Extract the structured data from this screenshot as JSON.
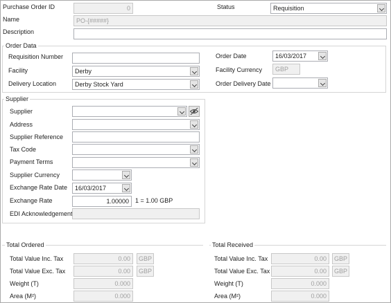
{
  "header": {
    "po_id_label": "Purchase Order ID",
    "po_id_value": "0",
    "status_label": "Status",
    "status_value": "Requisition",
    "name_label": "Name",
    "name_placeholder": "PO-{#####}",
    "description_label": "Description",
    "description_value": ""
  },
  "order_data": {
    "title": "Order Data",
    "requisition_number_label": "Requisition Number",
    "requisition_number_value": "",
    "facility_label": "Facility",
    "facility_value": "Derby",
    "delivery_location_label": "Delivery Location",
    "delivery_location_value": "Derby Stock Yard",
    "order_date_label": "Order Date",
    "order_date_value": "16/03/2017",
    "facility_currency_label": "Facility Currency",
    "facility_currency_value": "GBP",
    "order_delivery_date_label": "Order Delivery Date",
    "order_delivery_date_value": ""
  },
  "supplier": {
    "title": "Supplier",
    "supplier_label": "Supplier",
    "supplier_value": "",
    "address_label": "Address",
    "address_value": "",
    "supplier_reference_label": "Supplier Reference",
    "supplier_reference_value": "",
    "tax_code_label": "Tax Code",
    "tax_code_value": "",
    "payment_terms_label": "Payment Terms",
    "payment_terms_value": "",
    "supplier_currency_label": "Supplier Currency",
    "supplier_currency_value": "",
    "exchange_rate_date_label": "Exchange Rate Date",
    "exchange_rate_date_value": "16/03/2017",
    "exchange_rate_label": "Exchange Rate",
    "exchange_rate_value": "1.00000",
    "exchange_rate_note": "1  = 1.00 GBP",
    "edi_label": "EDI Acknowledgement",
    "edi_value": ""
  },
  "totals": {
    "ordered": {
      "title": "Total Ordered",
      "inc_tax_label": "Total Value Inc. Tax",
      "inc_tax_value": "0.00",
      "inc_tax_unit": "GBP",
      "exc_tax_label": "Total Value Exc. Tax",
      "exc_tax_value": "0.00",
      "exc_tax_unit": "GBP",
      "weight_label": "Weight (T)",
      "weight_value": "0.000",
      "area_label": "Area (M²)",
      "area_value": "0.000"
    },
    "received": {
      "title": "Total Received",
      "inc_tax_label": "Total Value Inc. Tax",
      "inc_tax_value": "0.00",
      "inc_tax_unit": "GBP",
      "exc_tax_label": "Total Value Exc. Tax",
      "exc_tax_value": "0.00",
      "exc_tax_unit": "GBP",
      "weight_label": "Weight (T)",
      "weight_value": "0.000",
      "area_label": "Area (M²)",
      "area_value": "0.000"
    }
  },
  "icons": {
    "dropdown": "chevron-down-icon",
    "supplier_lookup": "eye-icon"
  },
  "colors": {
    "field_border": "#abadb3",
    "readonly_background": "#f0f0f0",
    "group_border": "#d5d5d5"
  }
}
